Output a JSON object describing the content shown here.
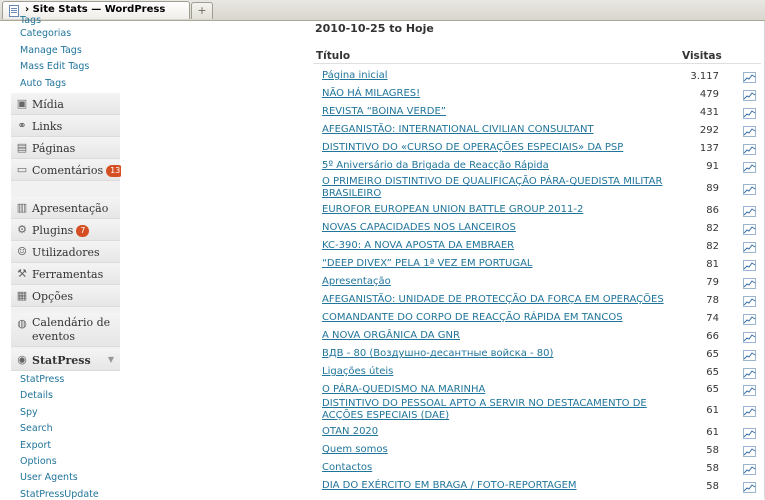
{
  "browser": {
    "tab_title": "› Site Stats — WordPress",
    "new_tab_symbol": "+"
  },
  "sidebar": {
    "top_subitems": [
      "Categorias",
      "Manage Tags",
      "Mass Edit Tags",
      "Auto Tags"
    ],
    "menu_group1": [
      {
        "label": "Mídia",
        "icon": "media-icon"
      },
      {
        "label": "Links",
        "icon": "links-icon"
      },
      {
        "label": "Páginas",
        "icon": "pages-icon"
      },
      {
        "label": "Comentários",
        "icon": "comments-icon",
        "badge": "13"
      }
    ],
    "menu_group2": [
      {
        "label": "Apresentação",
        "icon": "appearance-icon"
      },
      {
        "label": "Plugins",
        "icon": "plugins-icon",
        "badge": "7"
      },
      {
        "label": "Utilizadores",
        "icon": "users-icon"
      },
      {
        "label": "Ferramentas",
        "icon": "tools-icon"
      },
      {
        "label": "Opções",
        "icon": "settings-icon"
      }
    ],
    "calendar": {
      "label": "Calendário de eventos",
      "icon": "calendar-icon"
    },
    "statpress": {
      "label": "StatPress",
      "icon": "statpress-icon",
      "subitems": [
        "StatPress",
        "Details",
        "Spy",
        "Search",
        "Export",
        "Options",
        "User Agents",
        "StatPressUpdate"
      ]
    }
  },
  "stats": {
    "date_range": "2010-10-25 to Hoje",
    "col_title": "Título",
    "col_visits": "Visitas",
    "rows": [
      {
        "title": "Página inicial",
        "visits": "3.117"
      },
      {
        "title": "NÃO HÁ MILAGRES!",
        "visits": "479"
      },
      {
        "title": "REVISTA “BOINA VERDE”",
        "visits": "431"
      },
      {
        "title": "AFEGANISTÃO: INTERNATIONAL CIVILIAN CONSULTANT",
        "visits": "292"
      },
      {
        "title": "DISTINTIVO DO «CURSO DE OPERAÇÕES ESPECIAIS» DA PSP",
        "visits": "137"
      },
      {
        "title": "5º Aniversário da Brigada de Reacção Rápida",
        "visits": "91"
      },
      {
        "title": "O PRIMEIRO DISTINTIVO DE QUALIFICAÇÃO PÁRA-QUEDISTA MILITAR BRASILEIRO",
        "visits": "89"
      },
      {
        "title": "EUROFOR EUROPEAN UNION BATTLE GROUP 2011-2",
        "visits": "86"
      },
      {
        "title": "NOVAS CAPACIDADES NOS LANCEIROS",
        "visits": "82"
      },
      {
        "title": "KC-390: A NOVA APOSTA DA EMBRAER",
        "visits": "82"
      },
      {
        "title": "“DEEP DIVEX” PELA 1ª VEZ EM PORTUGAL",
        "visits": "81"
      },
      {
        "title": "Apresentação",
        "visits": "79"
      },
      {
        "title": "AFEGANISTÃO: UNIDADE DE PROTECÇÃO DA FORÇA EM OPERAÇÕES",
        "visits": "78"
      },
      {
        "title": "COMANDANTE DO CORPO DE REACÇÃO RÁPIDA EM TANCOS",
        "visits": "74"
      },
      {
        "title": "A NOVA ORGÂNICA DA GNR",
        "visits": "66"
      },
      {
        "title": "ВДВ - 80 (Воздушно-десантные войска - 80)",
        "visits": "65"
      },
      {
        "title": "Ligações úteis",
        "visits": "65"
      },
      {
        "title": "O PÁRA-QUEDISMO NA MARINHA",
        "visits": "65"
      },
      {
        "title": "DISTINTIVO DO PESSOAL APTO A SERVIR NO DESTACAMENTO DE ACÇÕES ESPECIAIS (DAE)",
        "visits": "61"
      },
      {
        "title": "OTAN 2020",
        "visits": "61"
      },
      {
        "title": "Quem somos",
        "visits": "58"
      },
      {
        "title": "Contactos",
        "visits": "58"
      },
      {
        "title": "DIA DO EXÉRCITO EM BRAGA / FOTO-REPORTAGEM",
        "visits": "58"
      }
    ]
  },
  "colors": {
    "link": "#21759b",
    "badge": "#d54e21",
    "sidebar_bg": "#f1f1f1"
  }
}
